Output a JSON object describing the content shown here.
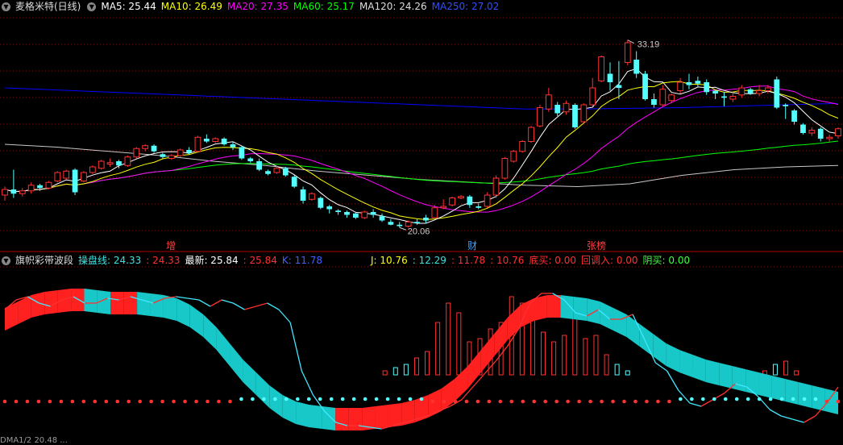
{
  "main_panel": {
    "title": "麦格米特(日线)",
    "ma": [
      {
        "label": "MA5: 25.44",
        "color": "#ffffff"
      },
      {
        "label": "MA10: 26.49",
        "color": "#ffff00"
      },
      {
        "label": "MA20: 27.35",
        "color": "#ff00ff"
      },
      {
        "label": "MA60: 25.17",
        "color": "#00ff00"
      },
      {
        "label": "MA120: 24.26",
        "color": "#c8c8c8"
      },
      {
        "label": "MA250: 27.02",
        "color": "#0000ff"
      }
    ],
    "high_label": "33.19",
    "low_label": "20.06",
    "markers": [
      {
        "text": "增",
        "color": "#ff4040"
      },
      {
        "text": "财",
        "color": "#40a0ff"
      },
      {
        "text": "张榜",
        "color": "#ff4040"
      }
    ]
  },
  "sub_panel": {
    "title": "旗帜彩带波段",
    "items": [
      {
        "label": "操盘线: 24.33",
        "color": "#40e0e0"
      },
      {
        "label": ": 24.33",
        "color": "#ff3030"
      },
      {
        "label": "最新: 25.84",
        "color": "#ffffff"
      },
      {
        "label": ": 25.84",
        "color": "#ff3030"
      },
      {
        "label": "K: 11.78",
        "color": "#4060ff"
      },
      {
        "label": "J: 10.76",
        "color": "#ffff00"
      },
      {
        "label": ": 12.29",
        "color": "#40e0e0"
      },
      {
        "label": ": 11.78",
        "color": "#ff3030"
      },
      {
        "label": ": 10.76",
        "color": "#ff3030"
      },
      {
        "label": "底买: 0.00",
        "color": "#ff3030"
      },
      {
        "label": "回调入: 0.00",
        "color": "#ff3030"
      },
      {
        "label": "阴买: 0.00",
        "color": "#40ff40"
      }
    ]
  },
  "bottom_text": "DMA1/2 20.48  ...",
  "chart_data": {
    "type": "candlestick",
    "title": "麦格米特(日线)",
    "y_range": [
      19,
      35
    ],
    "candles": [
      [
        22.2,
        22.6,
        21.8,
        22.8
      ],
      [
        22.6,
        22.3,
        22.0,
        24.0
      ],
      [
        22.3,
        22.5,
        22.1,
        22.7
      ],
      [
        22.5,
        22.9,
        22.3,
        23.1
      ],
      [
        22.9,
        22.7,
        22.5,
        23.0
      ],
      [
        22.7,
        23.1,
        22.6,
        23.2
      ],
      [
        23.2,
        23.8,
        23.1,
        23.9
      ],
      [
        23.4,
        23.9,
        23.3,
        24.0
      ],
      [
        24.0,
        22.4,
        22.2,
        24.1
      ],
      [
        23.2,
        23.8,
        23.1,
        23.9
      ],
      [
        23.8,
        24.2,
        23.7,
        24.3
      ],
      [
        24.1,
        24.6,
        24.0,
        24.7
      ],
      [
        24.4,
        24.5,
        24.2,
        24.8
      ],
      [
        24.6,
        24.3,
        24.1,
        24.7
      ],
      [
        24.3,
        24.9,
        24.2,
        25.0
      ],
      [
        24.9,
        25.5,
        24.8,
        25.6
      ],
      [
        25.5,
        25.7,
        25.3,
        25.8
      ],
      [
        25.7,
        25.3,
        25.2,
        25.8
      ],
      [
        25.1,
        24.9,
        24.8,
        25.2
      ],
      [
        24.8,
        25.0,
        24.7,
        25.1
      ],
      [
        25.0,
        25.4,
        24.9,
        25.5
      ],
      [
        25.4,
        25.2,
        25.1,
        25.6
      ],
      [
        25.3,
        26.3,
        25.2,
        26.4
      ],
      [
        26.2,
        26.0,
        25.9,
        26.5
      ],
      [
        26.0,
        26.2,
        25.9,
        26.3
      ],
      [
        26.2,
        25.8,
        25.7,
        26.3
      ],
      [
        25.8,
        25.6,
        25.4,
        26.0
      ],
      [
        25.6,
        24.8,
        24.7,
        25.7
      ],
      [
        24.8,
        24.6,
        24.5,
        24.9
      ],
      [
        24.6,
        24.0,
        23.9,
        24.8
      ],
      [
        23.9,
        23.7,
        23.6,
        24.0
      ],
      [
        23.8,
        24.1,
        23.7,
        24.3
      ],
      [
        24.1,
        23.6,
        23.5,
        24.2
      ],
      [
        23.5,
        22.8,
        22.7,
        23.6
      ],
      [
        22.6,
        21.8,
        21.6,
        22.8
      ],
      [
        21.9,
        22.3,
        21.8,
        22.4
      ],
      [
        22.0,
        21.3,
        21.2,
        22.1
      ],
      [
        21.4,
        21.2,
        20.9,
        21.5
      ],
      [
        21.1,
        21.0,
        20.8,
        21.2
      ],
      [
        21.0,
        20.8,
        20.6,
        21.1
      ],
      [
        20.9,
        20.6,
        20.5,
        21.0
      ],
      [
        20.6,
        21.0,
        20.5,
        21.1
      ],
      [
        21.0,
        20.8,
        20.6,
        21.2
      ],
      [
        20.7,
        20.4,
        20.3,
        20.9
      ],
      [
        20.3,
        20.1,
        20.06,
        20.5
      ],
      [
        20.1,
        20.0,
        19.9,
        20.3
      ],
      [
        20.0,
        20.3,
        19.9,
        20.4
      ],
      [
        20.3,
        20.2,
        20.1,
        20.5
      ],
      [
        20.6,
        20.4,
        20.2,
        20.8
      ],
      [
        20.6,
        21.3,
        20.5,
        21.5
      ],
      [
        21.3,
        21.4,
        21.2,
        21.9
      ],
      [
        21.5,
        22.0,
        21.4,
        22.1
      ],
      [
        22.0,
        22.1,
        21.9,
        22.2
      ],
      [
        22.1,
        21.5,
        21.3,
        22.2
      ],
      [
        21.4,
        21.3,
        21.2,
        21.6
      ],
      [
        21.4,
        22.2,
        21.3,
        22.4
      ],
      [
        22.2,
        23.4,
        22.0,
        23.6
      ],
      [
        23.4,
        24.8,
        23.3,
        24.9
      ],
      [
        24.6,
        25.3,
        24.5,
        25.4
      ],
      [
        25.3,
        26.0,
        25.2,
        26.1
      ],
      [
        26.0,
        27.0,
        25.9,
        27.1
      ],
      [
        27.1,
        28.4,
        27.0,
        28.6
      ],
      [
        28.3,
        29.3,
        28.1,
        29.8
      ],
      [
        28.6,
        28.0,
        27.8,
        28.8
      ],
      [
        28.1,
        28.7,
        27.9,
        28.9
      ],
      [
        28.6,
        27.0,
        26.9,
        28.7
      ],
      [
        27.4,
        28.6,
        27.3,
        28.7
      ],
      [
        28.6,
        29.8,
        28.5,
        30.5
      ],
      [
        30.3,
        32.0,
        30.2,
        32.1
      ],
      [
        30.8,
        30.2,
        29.6,
        31.6
      ],
      [
        30.0,
        29.8,
        29.0,
        31.7
      ],
      [
        31.6,
        33.0,
        31.4,
        33.19
      ],
      [
        31.8,
        30.8,
        30.5,
        32.4
      ],
      [
        30.8,
        29.0,
        28.9,
        31.0
      ],
      [
        29.0,
        28.6,
        28.4,
        29.4
      ],
      [
        28.6,
        29.7,
        28.5,
        30.0
      ],
      [
        28.9,
        29.3,
        28.7,
        29.4
      ],
      [
        29.6,
        30.2,
        29.4,
        30.5
      ],
      [
        30.2,
        30.0,
        29.7,
        30.8
      ],
      [
        30.3,
        30.1,
        29.9,
        30.6
      ],
      [
        30.2,
        29.5,
        29.3,
        30.4
      ],
      [
        29.6,
        29.4,
        29.0,
        29.7
      ],
      [
        29.2,
        29.1,
        28.5,
        29.5
      ],
      [
        29.0,
        29.2,
        28.8,
        29.5
      ],
      [
        29.3,
        29.8,
        29.1,
        30.0
      ],
      [
        29.7,
        29.4,
        29.3,
        29.8
      ],
      [
        29.4,
        29.6,
        29.2,
        30.0
      ],
      [
        29.6,
        29.8,
        29.4,
        30.0
      ],
      [
        30.4,
        28.4,
        28.3,
        30.6
      ],
      [
        28.6,
        28.5,
        27.6,
        28.7
      ],
      [
        28.2,
        27.4,
        27.2,
        28.3
      ],
      [
        27.2,
        26.6,
        26.5,
        27.3
      ],
      [
        26.6,
        26.8,
        26.4,
        27.0
      ],
      [
        26.9,
        26.2,
        26.0,
        27.0
      ],
      [
        26.2,
        26.3,
        26.0,
        26.5
      ],
      [
        26.4,
        26.9,
        26.2,
        27.0
      ]
    ],
    "series": [
      {
        "name": "MA5",
        "color": "#ffffff"
      },
      {
        "name": "MA10",
        "color": "#ffff00"
      },
      {
        "name": "MA20",
        "color": "#ff00ff"
      },
      {
        "name": "MA60",
        "color": "#00ff00"
      },
      {
        "name": "MA120",
        "color": "#c8c8c8"
      },
      {
        "name": "MA250",
        "color": "#0000ff"
      }
    ],
    "ma250_points": [
      29.8,
      29.65,
      29.5,
      29.35,
      29.2,
      29.05,
      28.9,
      28.75,
      28.6,
      28.45,
      28.3,
      28.3,
      28.35,
      28.4,
      28.5,
      28.6,
      28.7
    ],
    "ma120_points": [
      25.8,
      25.6,
      25.3,
      25.0,
      24.6,
      24.3,
      23.9,
      23.6,
      23.3,
      23.1,
      22.9,
      22.8,
      23.0,
      23.6,
      24.0,
      24.2,
      24.3
    ],
    "sub_y_range": [
      0,
      100
    ],
    "sub_lines": {
      "fast": [
        78,
        84,
        86,
        82,
        80,
        84,
        86,
        82,
        82,
        85,
        84,
        86,
        84,
        82,
        85,
        86,
        85,
        84,
        80,
        84,
        82,
        78,
        80,
        82,
        78,
        70,
        40,
        25,
        15,
        8,
        6,
        6,
        5,
        4,
        6,
        8,
        10,
        12,
        15,
        18,
        22,
        30,
        38,
        46,
        55,
        66,
        82,
        88,
        88,
        84,
        76,
        74,
        78,
        72,
        72,
        75,
        60,
        45,
        40,
        28,
        20,
        18,
        22,
        26,
        32,
        30,
        24,
        16,
        12,
        10,
        8,
        12,
        20,
        30
      ],
      "slow": [
        72,
        76,
        80,
        82,
        83,
        84,
        84,
        83,
        82,
        82,
        82,
        81,
        80,
        78,
        74,
        68,
        60,
        50,
        40,
        32,
        24,
        18,
        14,
        12,
        11,
        10,
        10,
        10,
        11,
        12,
        13,
        15,
        18,
        22,
        28,
        36,
        46,
        56,
        66,
        74,
        78,
        80,
        80,
        79,
        78,
        76,
        72,
        68,
        62,
        56,
        50,
        46,
        43,
        40,
        38,
        36,
        34,
        32,
        30,
        28,
        26,
        24,
        22,
        20
      ],
      "bars": [
        35,
        20,
        18,
        20,
        22,
        20,
        22,
        19,
        18,
        20,
        22,
        20,
        18,
        22,
        20,
        18,
        20,
        22,
        18,
        20,
        22,
        20,
        18,
        20,
        22,
        24,
        22,
        18,
        20,
        20,
        22,
        24,
        26,
        28,
        30,
        36,
        40,
        42,
        44,
        48,
        52,
        70,
        82,
        76,
        58,
        60,
        66,
        70,
        86,
        82,
        72,
        64,
        58,
        62,
        76,
        60,
        62,
        50,
        44,
        40,
        34,
        32,
        28,
        30,
        36,
        38,
        32,
        30,
        28,
        26,
        30,
        34,
        40,
        44,
        46,
        40,
        34,
        30,
        26,
        24
      ]
    }
  }
}
